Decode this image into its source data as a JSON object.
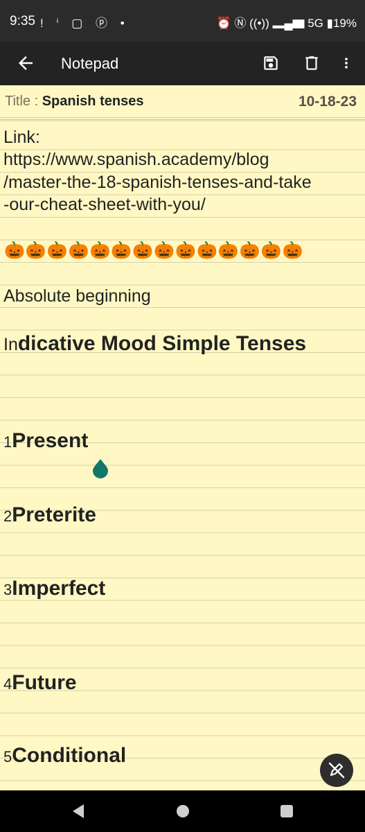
{
  "status_bar": {
    "time": "9:35",
    "left_icons": "! ⁱ ▢ ⓟ •",
    "right_icons": "⏰ Ⓝ ((•)) ▂▄▆ 5G ▮19%",
    "battery": "19%"
  },
  "app_bar": {
    "title": "Notepad",
    "icons": [
      "back-arrow-icon",
      "save-icon",
      "delete-icon",
      "more-vert-icon"
    ]
  },
  "note": {
    "title_label": "Title : ",
    "title_value": "Spanish tenses",
    "date": "10-18-23",
    "link_label": "Link:",
    "link_lines": [
      "https://www.spanish.academy/blog",
      "/master-the-18-spanish-tenses-and-take",
      "-our-cheat-sheet-with-you/"
    ],
    "pumpkins": "🎃🎃🎃🎃🎃🎃🎃🎃🎃🎃🎃🎃🎃🎃",
    "subtitle": "Absolute beginning",
    "section_prefix": "In",
    "section_heading": "dicative Mood Simple Tenses",
    "tenses": [
      {
        "num": "1",
        "name": "Present"
      },
      {
        "num": "2",
        "name": "Preterite"
      },
      {
        "num": "3",
        "name": "Imperfect"
      },
      {
        "num": "4",
        "name": "Future"
      },
      {
        "num": "5",
        "name": "Conditional"
      }
    ]
  },
  "colors": {
    "paper": "#fff8c4",
    "rule": "#d6d2a8",
    "accent_teal": "#11776b",
    "app_bar": "#232323"
  }
}
